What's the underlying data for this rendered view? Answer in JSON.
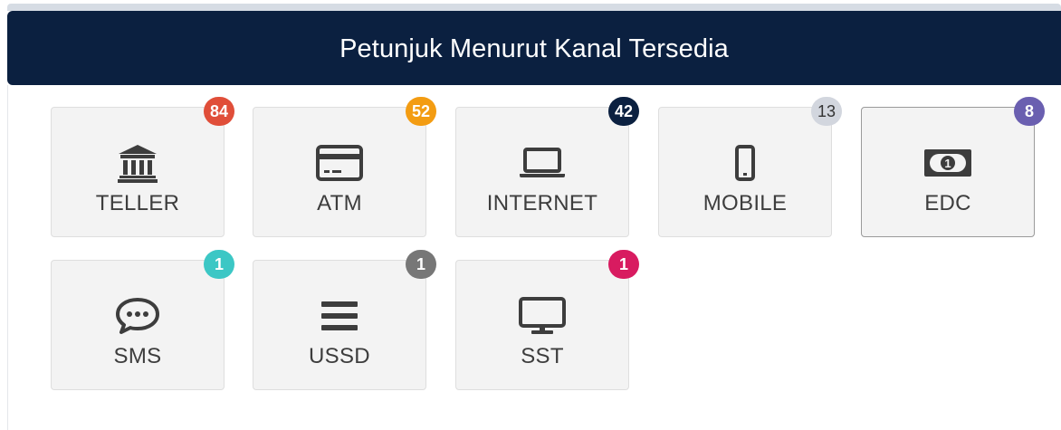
{
  "header": {
    "title": "Petunjuk Menurut Kanal Tersedia"
  },
  "channels": [
    {
      "label": "TELLER",
      "count": "84",
      "badge_color": "#e04e39",
      "icon": "bank-icon"
    },
    {
      "label": "ATM",
      "count": "52",
      "badge_color": "#f39c12",
      "icon": "credit-card-icon"
    },
    {
      "label": "INTERNET",
      "count": "42",
      "badge_color": "#0b2040",
      "icon": "laptop-icon"
    },
    {
      "label": "MOBILE",
      "count": "13",
      "badge_color": "#d2d6de",
      "icon": "mobile-phone-icon"
    },
    {
      "label": "EDC",
      "count": "8",
      "badge_color": "#6a5fb0",
      "icon": "money-bill-icon",
      "active": true
    },
    {
      "label": "SMS",
      "count": "1",
      "badge_color": "#3cc7c5",
      "icon": "chat-bubble-icon"
    },
    {
      "label": "USSD",
      "count": "1",
      "badge_color": "#777777",
      "icon": "menu-lines-icon"
    },
    {
      "label": "SST",
      "count": "1",
      "badge_color": "#d81b60",
      "icon": "desktop-monitor-icon"
    }
  ]
}
